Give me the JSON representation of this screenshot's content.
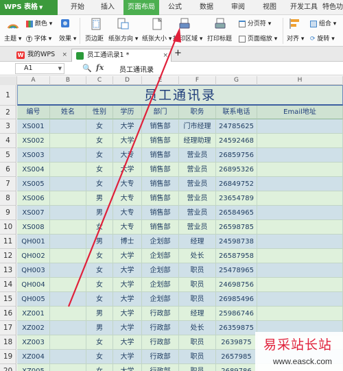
{
  "app": {
    "name": "WPS 表格",
    "accent": "#3c9a3c"
  },
  "menu": {
    "tabs": [
      {
        "label": "开始"
      },
      {
        "label": "插入"
      },
      {
        "label": "页面布局",
        "active": true
      },
      {
        "label": "公式"
      },
      {
        "label": "数据"
      },
      {
        "label": "审阅"
      },
      {
        "label": "视图"
      },
      {
        "label": "开发工具"
      },
      {
        "label": "特色功"
      }
    ]
  },
  "ribbon": {
    "theme": "主题",
    "color": "颜色",
    "font": "字体",
    "effect": "效果",
    "margins": "页边距",
    "orientation": "纸张方向",
    "size": "纸张大小",
    "print_area": "打印区域",
    "print_titles": "打印标题",
    "page_break": "分页符",
    "page_scale": "页面缩放",
    "align": "对齐",
    "group": "组合",
    "rotate": "旋转"
  },
  "doc_tabs": [
    {
      "label": "我的WPS",
      "icon": "wps-logo-icon"
    },
    {
      "label": "员工通讯录1 *",
      "icon": "spreadsheet-icon",
      "active": true
    }
  ],
  "add_tab": "+",
  "formula_bar": {
    "cell_ref": "A1",
    "fx": "fx",
    "value": "员工通讯录"
  },
  "columns": [
    "A",
    "B",
    "C",
    "D",
    "E",
    "F",
    "G",
    "H"
  ],
  "sheet": {
    "title": "员工通讯录",
    "headers": [
      "编号",
      "姓名",
      "性别",
      "学历",
      "部门",
      "职务",
      "联系电话",
      "Email地址"
    ],
    "rows": [
      {
        "n": "3",
        "cells": [
          "XS001",
          "",
          "女",
          "大学",
          "销售部",
          "门市经理",
          "24785625",
          ""
        ]
      },
      {
        "n": "4",
        "cells": [
          "XS002",
          "",
          "女",
          "大学",
          "销售部",
          "经理助理",
          "24592468",
          ""
        ]
      },
      {
        "n": "5",
        "cells": [
          "XS003",
          "",
          "女",
          "大专",
          "销售部",
          "营业员",
          "26859756",
          ""
        ]
      },
      {
        "n": "6",
        "cells": [
          "XS004",
          "",
          "女",
          "大学",
          "销售部",
          "营业员",
          "26895326",
          ""
        ]
      },
      {
        "n": "7",
        "cells": [
          "XS005",
          "",
          "女",
          "大专",
          "销售部",
          "营业员",
          "26849752",
          ""
        ]
      },
      {
        "n": "8",
        "cells": [
          "XS006",
          "",
          "男",
          "大专",
          "销售部",
          "营业员",
          "23654789",
          ""
        ]
      },
      {
        "n": "9",
        "cells": [
          "XS007",
          "",
          "男",
          "大专",
          "销售部",
          "营业员",
          "26584965",
          ""
        ]
      },
      {
        "n": "10",
        "cells": [
          "XS008",
          "",
          "女",
          "大专",
          "销售部",
          "营业员",
          "26598785",
          ""
        ]
      },
      {
        "n": "11",
        "cells": [
          "QH001",
          "",
          "男",
          "博士",
          "企划部",
          "经理",
          "24598738",
          ""
        ]
      },
      {
        "n": "12",
        "cells": [
          "QH002",
          "",
          "女",
          "大学",
          "企划部",
          "处长",
          "26587958",
          ""
        ]
      },
      {
        "n": "13",
        "cells": [
          "QH003",
          "",
          "女",
          "大学",
          "企划部",
          "职员",
          "25478965",
          ""
        ]
      },
      {
        "n": "14",
        "cells": [
          "QH004",
          "",
          "女",
          "大学",
          "企划部",
          "职员",
          "24698756",
          ""
        ]
      },
      {
        "n": "15",
        "cells": [
          "QH005",
          "",
          "女",
          "大学",
          "企划部",
          "职员",
          "26985496",
          ""
        ]
      },
      {
        "n": "16",
        "cells": [
          "XZ001",
          "",
          "男",
          "大学",
          "行政部",
          "经理",
          "25986746",
          ""
        ]
      },
      {
        "n": "17",
        "cells": [
          "XZ002",
          "",
          "男",
          "大学",
          "行政部",
          "处长",
          "26359875",
          ""
        ]
      },
      {
        "n": "18",
        "cells": [
          "XZ003",
          "",
          "女",
          "大学",
          "行政部",
          "职员",
          "2639875",
          ""
        ]
      },
      {
        "n": "19",
        "cells": [
          "XZ004",
          "",
          "女",
          "大学",
          "行政部",
          "职员",
          "2657985",
          ""
        ]
      },
      {
        "n": "20",
        "cells": [
          "XZ005",
          "",
          "女",
          "大学",
          "行政部",
          "职员",
          "2689786",
          ""
        ]
      }
    ]
  },
  "watermark": {
    "line1": "易采站长站",
    "line2": "www.easck.com"
  },
  "colors": {
    "title_text": "#1f3d7a",
    "row_odd": "#cfe0e8",
    "row_even": "#dff1dc",
    "arrow": "#e0203a"
  }
}
